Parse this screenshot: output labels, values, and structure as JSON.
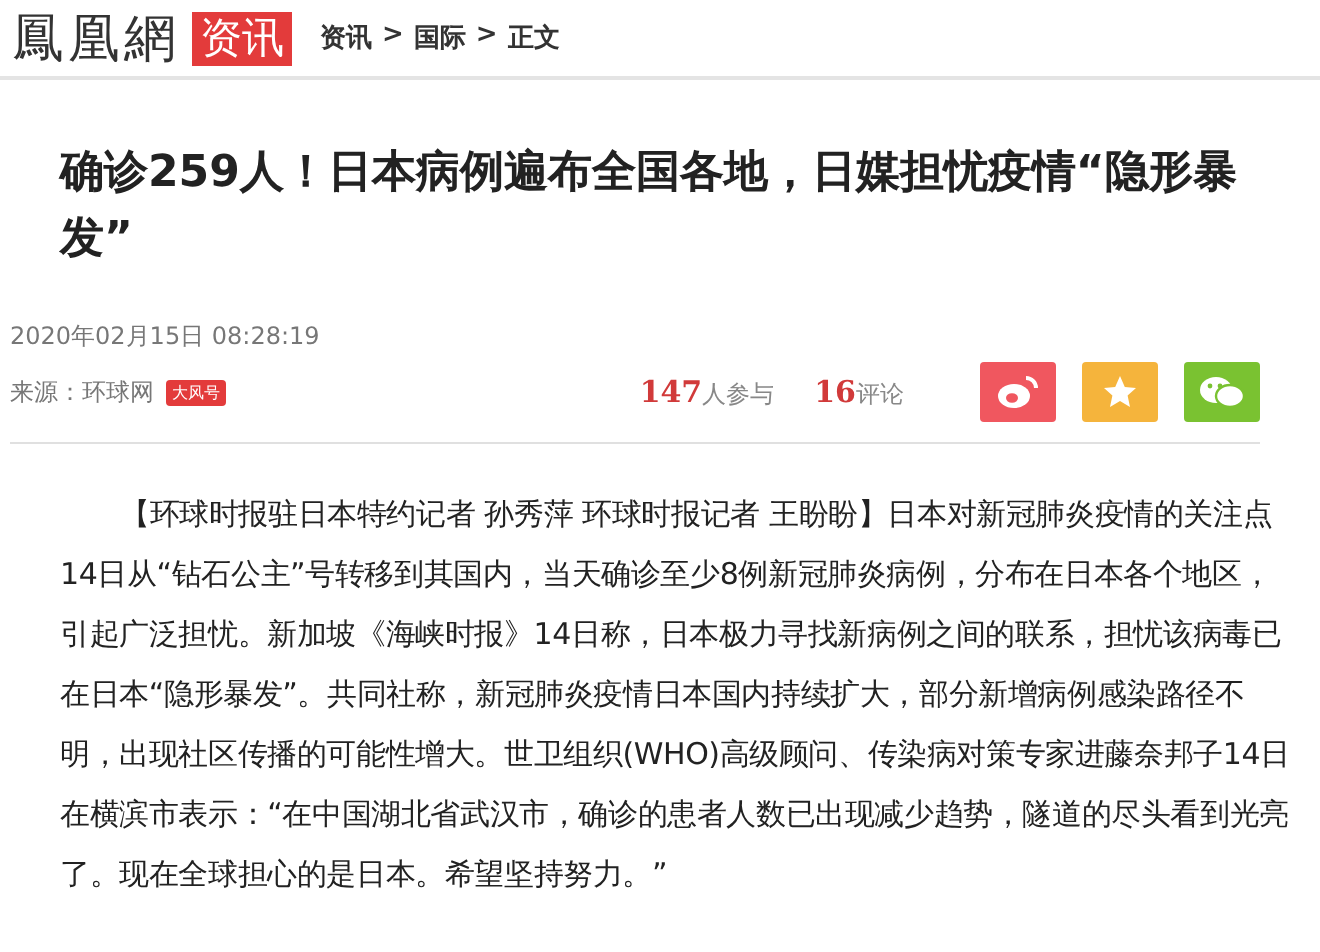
{
  "header": {
    "logo": "鳳凰網",
    "channel": "资讯",
    "breadcrumb": [
      "资讯",
      "国际",
      "正文"
    ],
    "separator": ">"
  },
  "article": {
    "title": "确诊259人！日本病例遍布全国各地，日媒担忧疫情“隐形暴发”",
    "datetime": "2020年02月15日 08:28:19",
    "source_label": "来源：环球网",
    "source_badge": "大风号",
    "stats": [
      {
        "count": "147",
        "label": "人参与"
      },
      {
        "count": "16",
        "label": "评论"
      }
    ],
    "share": [
      {
        "kind": "weibo"
      },
      {
        "kind": "favorite"
      },
      {
        "kind": "wechat"
      }
    ],
    "body": "【环球时报驻日本特约记者 孙秀萍 环球时报记者 王盼盼】日本对新冠肺炎疫情的关注点14日从“钻石公主”号转移到其国内，当天确诊至少8例新冠肺炎病例，分布在日本各个地区，引起广泛担忧。新加坡《海峡时报》14日称，日本极力寻找新病例之间的联系，担忧该病毒已在日本“隐形暴发”。共同社称，新冠肺炎疫情日本国内持续扩大，部分新增病例感染路径不明，出现社区传播的可能性增大。世卫组织(WHO)高级顾问、传染病对策专家进藤奈邦子14日在横滨市表示：“在中国湖北省武汉市，确诊的患者人数已出现减少趋势，隧道的尽头看到光亮了。现在全球担心的是日本。希望坚持努力。”"
  }
}
